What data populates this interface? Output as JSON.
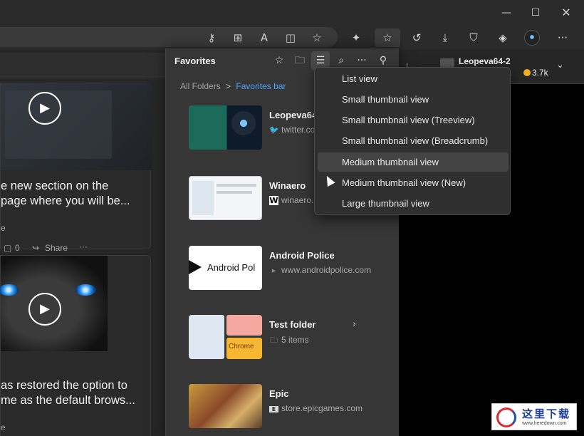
{
  "window": {
    "minimize_icon": "minimize-icon",
    "maximize_icon": "maximize-icon",
    "close_icon": "close-icon"
  },
  "toolbar": {
    "icons": [
      "key-icon",
      "apps-icon",
      "read-aloud-icon",
      "split-screen-icon",
      "add-favorite-icon",
      "extensions-icon",
      "favorites-icon",
      "history-icon",
      "downloads-icon",
      "browser-essentials-icon",
      "copilot-icon",
      "profile-avatar",
      "more-icon"
    ]
  },
  "background_page": {
    "header_user": "Leopeva64-2",
    "header_sub": "na",
    "header_points": "3.7k",
    "card1": {
      "title_line1": "e new section on the",
      "title_line2": "page where you will be...",
      "meta_line1": "e",
      "reactions": "0",
      "share": "Share",
      "more": "···"
    },
    "card2": {
      "title_line1": "as restored the option to",
      "title_line2": "me as the default brows...",
      "meta_line1": "e"
    }
  },
  "favorites": {
    "title": "Favorites",
    "breadcrumb": {
      "root": "All Folders",
      "separator": ">",
      "current": "Favorites bar"
    },
    "items": [
      {
        "name": "Leopeva64",
        "url": "twitter.co",
        "icon": "twitter-icon"
      },
      {
        "name": "Winaero",
        "url": "winaero.c",
        "icon": "winaero-icon"
      },
      {
        "name": "Android Police",
        "url": "www.androidpolice.com",
        "icon": "android-police-icon",
        "thumb_text": "Android Pol"
      },
      {
        "name": "Test folder",
        "url": "5 items",
        "icon": "folder-icon",
        "thumb_text": "Chrome"
      },
      {
        "name": "Epic",
        "url": "store.epicgames.com",
        "icon": "epic-icon"
      }
    ]
  },
  "view_menu": {
    "items": [
      "List view",
      "Small thumbnail view",
      "Small thumbnail view (Treeview)",
      "Small thumbnail view (Breadcrumb)",
      "Medium thumbnail view",
      "Medium thumbnail view (New)",
      "Large thumbnail view"
    ],
    "hovered_index": 4
  },
  "watermark": {
    "chinese": "这里下载",
    "url": "www.heredown.com"
  },
  "colors": {
    "accent": "#4aa3ff",
    "panel_bg": "#363636",
    "menu_bg": "#2f2f2f",
    "coin": "#f0b020"
  }
}
